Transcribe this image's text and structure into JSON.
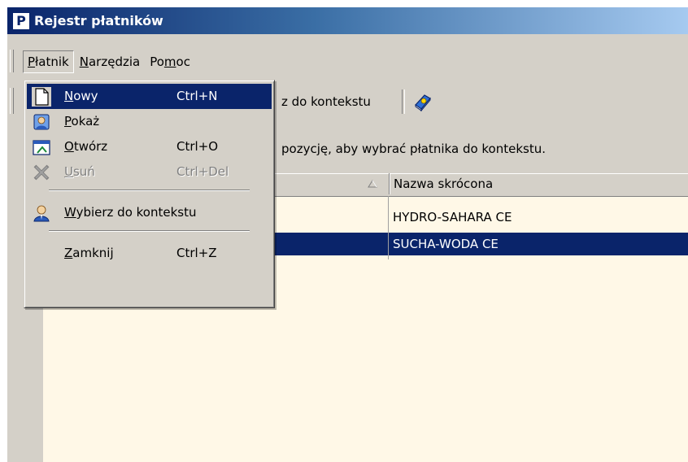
{
  "window": {
    "title": "Rejestr płatników",
    "app_icon_letter": "P"
  },
  "menubar": {
    "items": [
      {
        "pre": "",
        "acc": "P",
        "post": "łatnik"
      },
      {
        "pre": "",
        "acc": "N",
        "post": "arzędzia"
      },
      {
        "pre": "Po",
        "acc": "m",
        "post": "oc"
      }
    ]
  },
  "toolbar": {
    "context_button_text": "z do kontekstu",
    "help_icon": "book-help-icon"
  },
  "info": {
    "text": "pozycję, aby wybrać płatnika do kontekstu."
  },
  "grid": {
    "columns": [
      {
        "label": "Nazwa skrócona"
      }
    ],
    "rows": [
      {
        "short_name": "HYDRO-SAHARA CE",
        "selected": false
      },
      {
        "short_name": "SUCHA-WODA CE",
        "selected": true
      }
    ]
  },
  "dropdown": {
    "items": [
      {
        "acc": "N",
        "rest": "owy",
        "shortcut": "Ctrl+N",
        "icon": "new-document-icon",
        "state": "highlighted"
      },
      {
        "acc": "P",
        "rest": "okaż",
        "shortcut": "",
        "icon": "show-person-icon",
        "state": "normal"
      },
      {
        "acc": "O",
        "rest": "twórz",
        "shortcut": "Ctrl+O",
        "icon": "open-window-icon",
        "state": "normal"
      },
      {
        "acc": "U",
        "rest": "suń",
        "shortcut": "Ctrl+Del",
        "icon": "delete-x-icon",
        "state": "disabled"
      },
      {
        "acc": "W",
        "rest": "ybierz do kontekstu",
        "shortcut": "",
        "icon": "select-user-icon",
        "state": "normal"
      },
      {
        "acc": "Z",
        "rest": "amknij",
        "shortcut": "Ctrl+Z",
        "icon": "",
        "state": "normal"
      }
    ]
  },
  "colors": {
    "selection": "#0a246a",
    "grid_background": "#fff8e7",
    "face": "#d4d0c8"
  }
}
